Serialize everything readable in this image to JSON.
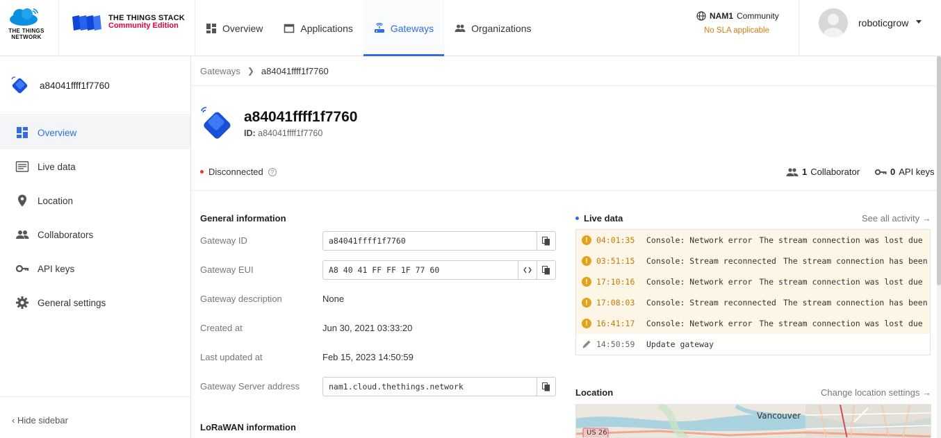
{
  "header": {
    "ttn_logo_text": "THE THINGS NETWORK",
    "tts_logo_line1": "THE THINGS STACK",
    "tts_logo_line2": "Community Edition",
    "nav": [
      {
        "label": "Overview",
        "icon": "grid-icon",
        "active": false
      },
      {
        "label": "Applications",
        "icon": "window-icon",
        "active": false
      },
      {
        "label": "Gateways",
        "icon": "router-icon",
        "active": true
      },
      {
        "label": "Organizations",
        "icon": "people-icon",
        "active": false
      }
    ],
    "cluster_name": "NAM1",
    "cluster_tier": "Community",
    "cluster_sla": "No SLA applicable",
    "username": "roboticgrow"
  },
  "sidebar": {
    "gateway_name": "a84041ffff1f7760",
    "items": [
      {
        "label": "Overview",
        "icon": "dashboard-icon",
        "active": true
      },
      {
        "label": "Live data",
        "icon": "list-icon",
        "active": false
      },
      {
        "label": "Location",
        "icon": "pin-icon",
        "active": false
      },
      {
        "label": "Collaborators",
        "icon": "people-icon",
        "active": false
      },
      {
        "label": "API keys",
        "icon": "key-icon",
        "active": false
      },
      {
        "label": "General settings",
        "icon": "gear-icon",
        "active": false
      }
    ],
    "hide_label": "‹ Hide sidebar"
  },
  "breadcrumb": {
    "root": "Gateways",
    "current": "a84041ffff1f7760"
  },
  "gateway": {
    "title": "a84041ffff1f7760",
    "id_label": "ID:",
    "id_value": "a84041ffff1f7760",
    "status": "Disconnected",
    "collaborator_count": "1",
    "collaborator_label": "Collaborator",
    "api_key_count": "0",
    "api_key_label": "API keys"
  },
  "general_info": {
    "title": "General information",
    "gateway_id_label": "Gateway ID",
    "gateway_id_value": "a84041ffff1f7760",
    "gateway_eui_label": "Gateway EUI",
    "gateway_eui_value": "A8 40 41 FF FF 1F 77 60",
    "description_label": "Gateway description",
    "description_value": "None",
    "created_label": "Created at",
    "created_value": "Jun 30, 2021 03:33:20",
    "updated_label": "Last updated at",
    "updated_value": "Feb 15, 2023 14:50:59",
    "server_label": "Gateway Server address",
    "server_value": "nam1.cloud.thethings.network",
    "lorawan_title": "LoRaWAN information"
  },
  "live_data": {
    "title": "Live data",
    "see_all": "See all activity →",
    "events": [
      {
        "type": "warn",
        "time": "04:01:35",
        "message": "Console: Network error",
        "description": "The stream connection was lost due"
      },
      {
        "type": "warn",
        "time": "03:51:15",
        "message": "Console: Stream reconnected",
        "description": "The stream connection has been"
      },
      {
        "type": "warn",
        "time": "17:10:16",
        "message": "Console: Network error",
        "description": "The stream connection was lost due"
      },
      {
        "type": "warn",
        "time": "17:08:03",
        "message": "Console: Stream reconnected",
        "description": "The stream connection has been"
      },
      {
        "type": "warn",
        "time": "16:41:17",
        "message": "Console: Network error",
        "description": "The stream connection was lost due"
      },
      {
        "type": "plain",
        "time": "14:50:59",
        "message": "Update gateway",
        "description": ""
      }
    ]
  },
  "location": {
    "title": "Location",
    "change": "Change location settings →",
    "map_city": "Vancouver",
    "map_road": "US 26"
  },
  "colors": {
    "accent": "#2f6ce5",
    "brand_red": "#e4003a",
    "warning": "#e1a31c",
    "sla": "#d97b12"
  }
}
